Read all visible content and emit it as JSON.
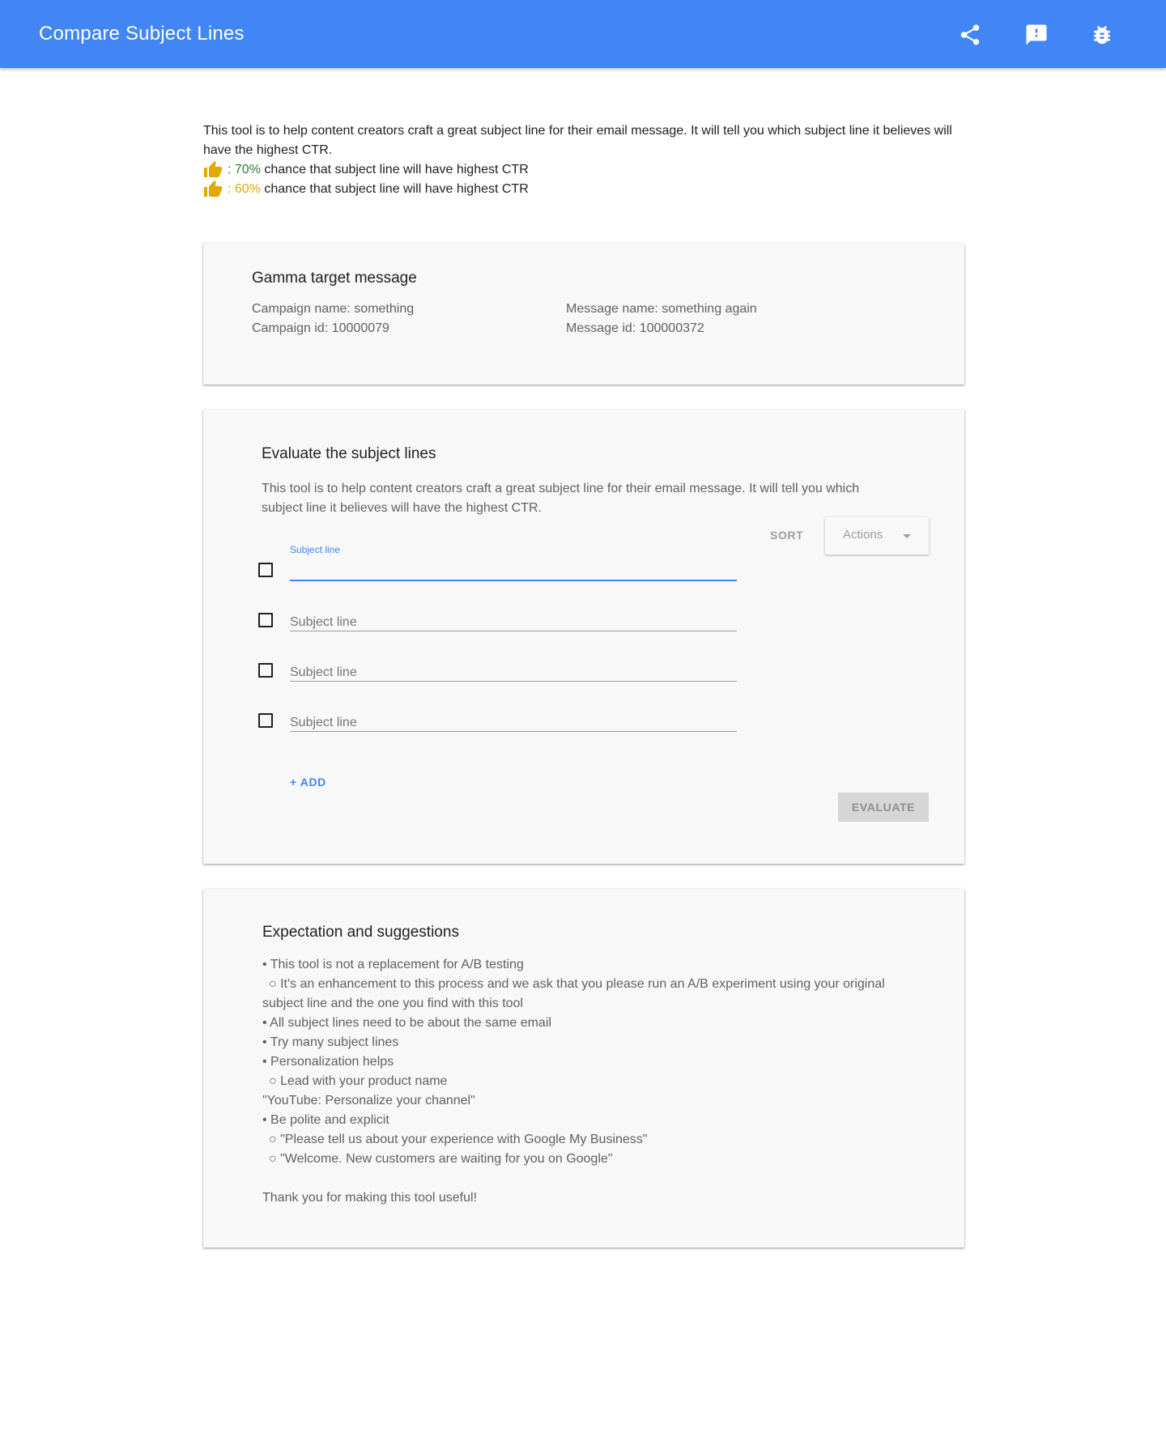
{
  "header": {
    "title": "Compare Subject Lines",
    "icons": [
      "share-icon",
      "feedback-icon",
      "bug-report-icon"
    ],
    "color": "#4285f4"
  },
  "intro": {
    "text": "This tool is to help content creators craft a great subject line for their email message. It will tell you which subject line it believes will have the highest CTR.",
    "legend": [
      {
        "percent": ": 70%",
        "text": " chance that subject line will have highest CTR",
        "color": "#2e7d32"
      },
      {
        "percent": ": 60%",
        "text": " chance that subject line will have highest CTR",
        "color": "#e0a800"
      }
    ]
  },
  "target_card": {
    "title": "Gamma target message",
    "campaign_name": "Campaign name: something",
    "campaign_id": "Campaign id: 10000079",
    "message_name": "Message name: something again",
    "message_id": "Message id: 100000372"
  },
  "evaluate_card": {
    "title": "Evaluate the subject lines",
    "description": "This tool is to help content creators craft a great subject line for their email message. It will tell you which subject line it believes will have the highest CTR.",
    "sort_label": "SORT",
    "actions_label": "Actions",
    "field_label": "Subject line",
    "fields": [
      {
        "placeholder": "",
        "value": ""
      },
      {
        "placeholder": "Subject line",
        "value": ""
      },
      {
        "placeholder": "Subject line",
        "value": ""
      },
      {
        "placeholder": "Subject line",
        "value": ""
      }
    ],
    "add_label": "+ ADD",
    "evaluate_label": "EVALUATE"
  },
  "suggestions_card": {
    "title": "Expectation and suggestions",
    "lines": [
      "• This tool is not a replacement for A/B testing",
      "○ It's an enhancement to this process and we ask that you please run an A/B experiment using your original",
      "subject line and the one you find with this tool",
      "• All subject lines need to be about the same email",
      "• Try many subject lines",
      "• Personalization helps",
      "○ Lead with your product name",
      "\"YouTube: Personalize your channel\"",
      "• Be polite and explicit",
      "○ \"Please tell us about your experience with Google My Business\"",
      "○ \"Welcome. New customers are waiting for you on Google\"",
      "",
      "Thank you for making this tool useful!"
    ]
  }
}
